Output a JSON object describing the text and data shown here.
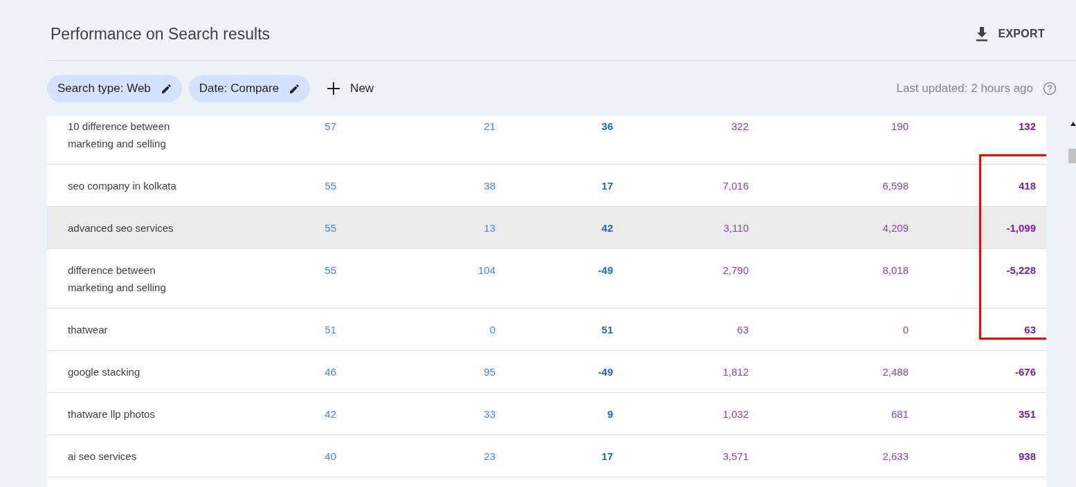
{
  "title": "Performance on Search results",
  "export_label": "EXPORT",
  "filters": [
    {
      "label": "Search type: Web"
    },
    {
      "label": "Date: Compare"
    }
  ],
  "new_label": "New",
  "last_updated": "Last updated: 2 hours ago",
  "annotation": {
    "color": "#ff0000"
  },
  "rows": [
    {
      "query": "10 difference between marketing and selling",
      "values": [
        "57",
        "21",
        "36",
        "322",
        "190",
        "132"
      ],
      "highlighted": false
    },
    {
      "query": "seo company in kolkata",
      "values": [
        "55",
        "38",
        "17",
        "7,016",
        "6,598",
        "418"
      ],
      "highlighted": false
    },
    {
      "query": "advanced seo services",
      "values": [
        "55",
        "13",
        "42",
        "3,110",
        "4,209",
        "-1,099"
      ],
      "highlighted": true
    },
    {
      "query": "difference between marketing and selling",
      "values": [
        "55",
        "104",
        "-49",
        "2,790",
        "8,018",
        "-5,228"
      ],
      "highlighted": false
    },
    {
      "query": "thatwear",
      "values": [
        "51",
        "0",
        "51",
        "63",
        "0",
        "63"
      ],
      "highlighted": false
    },
    {
      "query": "google stacking",
      "values": [
        "46",
        "95",
        "-49",
        "1,812",
        "2,488",
        "-676"
      ],
      "highlighted": false
    },
    {
      "query": "thatware llp photos",
      "values": [
        "42",
        "33",
        "9",
        "1,032",
        "681",
        "351"
      ],
      "highlighted": false
    },
    {
      "query": "ai seo services",
      "values": [
        "40",
        "23",
        "17",
        "3,571",
        "2,633",
        "938"
      ],
      "highlighted": false
    }
  ]
}
